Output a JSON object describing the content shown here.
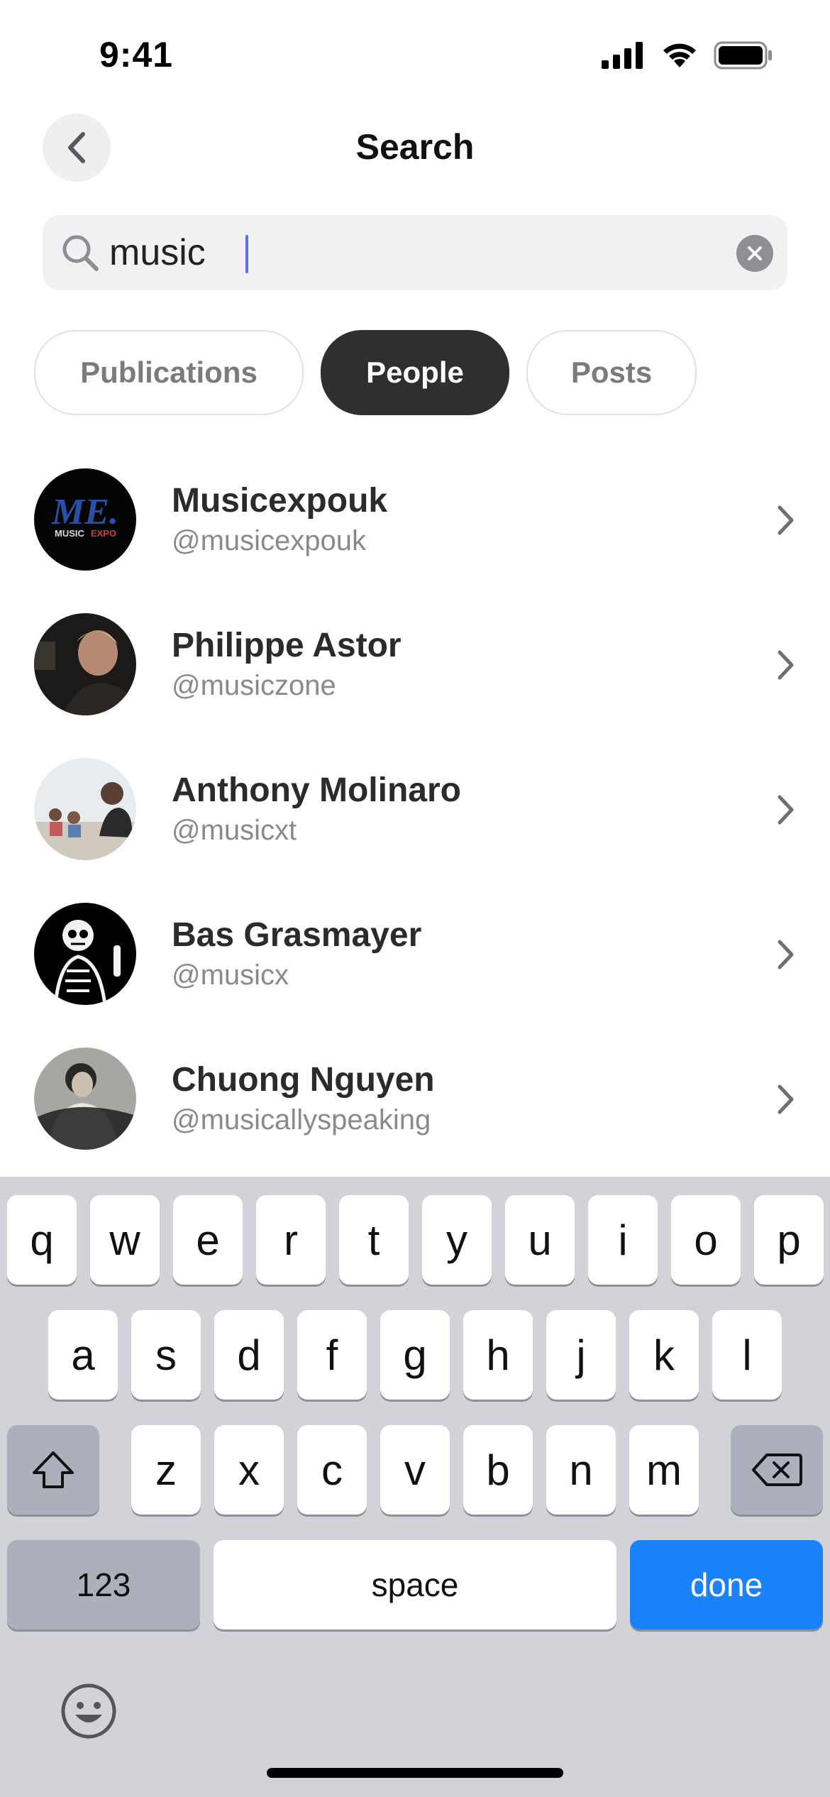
{
  "status_bar": {
    "time": "9:41"
  },
  "header": {
    "title": "Search",
    "back_icon": "chevron-left-icon"
  },
  "search": {
    "value": "music",
    "placeholder": "",
    "clear_icon": "clear-circle-icon"
  },
  "tabs": [
    {
      "label": "Publications",
      "active": false
    },
    {
      "label": "People",
      "active": true
    },
    {
      "label": "Posts",
      "active": false
    }
  ],
  "results": [
    {
      "name": "Musicexpouk",
      "handle": "@musicexpouk",
      "avatar_logo": [
        "ME.",
        "MUSIC",
        "EXPO"
      ]
    },
    {
      "name": "Philippe Astor",
      "handle": "@musiczone"
    },
    {
      "name": "Anthony Molinaro",
      "handle": "@musicxt"
    },
    {
      "name": "Bas Grasmayer",
      "handle": "@musicx"
    },
    {
      "name": "Chuong Nguyen",
      "handle": "@musicallyspeaking"
    }
  ],
  "keyboard": {
    "row1": [
      "q",
      "w",
      "e",
      "r",
      "t",
      "y",
      "u",
      "i",
      "o",
      "p"
    ],
    "row2": [
      "a",
      "s",
      "d",
      "f",
      "g",
      "h",
      "j",
      "k",
      "l"
    ],
    "row3": [
      "z",
      "x",
      "c",
      "v",
      "b",
      "n",
      "m"
    ],
    "numbers_label": "123",
    "space_label": "space",
    "done_label": "done",
    "shift_icon": "shift-icon",
    "delete_icon": "backspace-icon",
    "emoji_icon": "emoji-icon"
  },
  "colors": {
    "accent": "#1a82fb",
    "active_tab": "#2f2e31",
    "caret": "#5b6cff"
  }
}
